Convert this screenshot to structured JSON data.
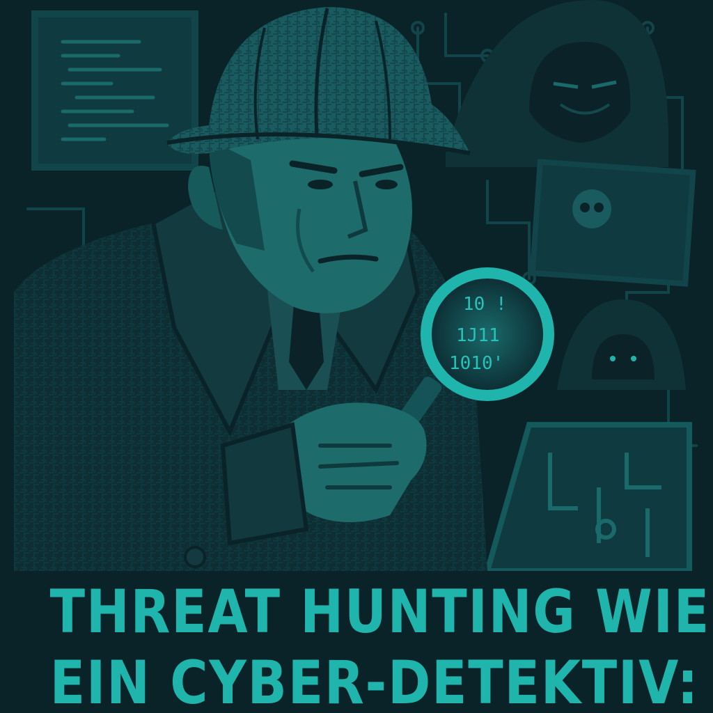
{
  "poster": {
    "headline_line1": "THREAT HUNTING WIE",
    "headline_line2": "EIN CYBER-DETEKTIV:",
    "lens_binary": [
      "10 !",
      "1J11",
      "1010'"
    ]
  },
  "colors": {
    "background": "#0a2329",
    "accent": "#1fb5ad",
    "dark_teal": "#0f3a40",
    "mid_teal": "#1a5b5f"
  }
}
